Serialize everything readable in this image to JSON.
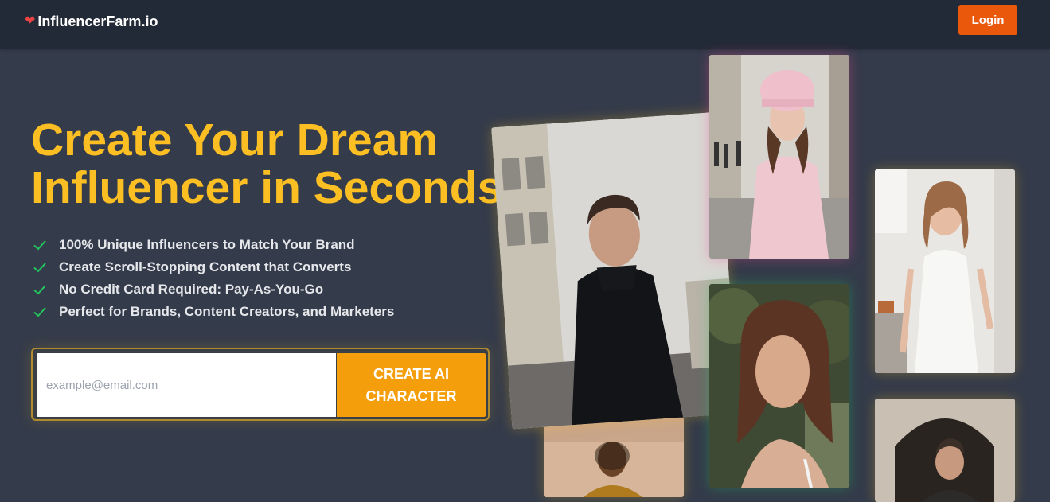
{
  "app": {
    "brand_name": "InfluencerFarm.io",
    "brand_icon": "heart-icon",
    "login_label": "Login"
  },
  "hero": {
    "headline_line1": "Create Your Dream",
    "headline_line2": "Influencer in Seconds",
    "features": [
      "100% Unique Influencers to Match Your Brand",
      "Create Scroll-Stopping Content that Converts",
      "No Credit Card Required: Pay-As-You-Go",
      "Perfect for Brands, Content Creators, and Marketers"
    ],
    "email_placeholder": "example@email.com",
    "email_value": "",
    "cta_line1": "CREATE AI",
    "cta_line2": "CHARACTER"
  },
  "gallery": {
    "photos": [
      "man-dark-coat-photo",
      "woman-pink-coat-photo",
      "woman-white-dress-photo",
      "woman-freckles-photo",
      "woman-smiling-photo",
      "man-archway-photo"
    ]
  },
  "colors": {
    "accent_yellow": "#fbbf24",
    "cta_orange": "#f59e0b",
    "login_orange": "#ea580c",
    "page_bg": "#343b4a",
    "nav_bg": "#232a37",
    "check_green": "#22c55e",
    "heart_red": "#ef4444"
  }
}
